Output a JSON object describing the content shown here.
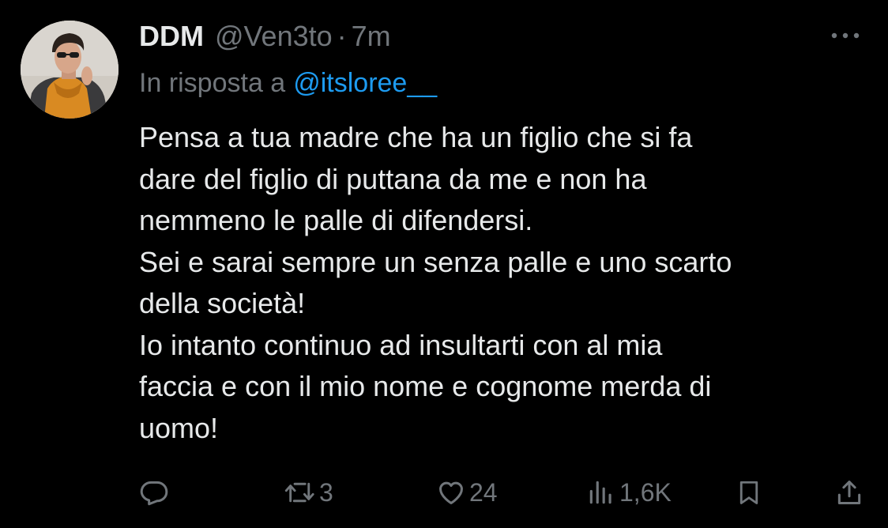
{
  "tweet": {
    "display_name": "DDM",
    "handle": "@Ven3to",
    "separator": "·",
    "time": "7m",
    "reply_prefix": "In risposta a",
    "reply_mention": "@itsloree__",
    "body_lines": [
      "Pensa a tua madre che ha un figlio che si fa",
      "dare del figlio di puttana da me e non ha",
      "nemmeno le palle di difendersi.",
      "Sei e sarai sempre un senza palle e uno scarto",
      "della società!",
      "Io intanto continuo ad insultarti con al mia",
      "faccia e con il mio nome e cognome merda di",
      "uomo!"
    ]
  },
  "actions": {
    "reply_icon": "reply-icon",
    "retweet_icon": "retweet-icon",
    "retweet_count": "3",
    "like_icon": "heart-icon",
    "like_count": "24",
    "views_icon": "views-icon",
    "views_count": "1,6K",
    "bookmark_icon": "bookmark-icon",
    "share_icon": "share-icon"
  },
  "more_icon": "more-icon",
  "colors": {
    "background": "#000000",
    "text_primary": "#e7e9ea",
    "text_secondary": "#71767b",
    "link": "#1d9bf0"
  }
}
